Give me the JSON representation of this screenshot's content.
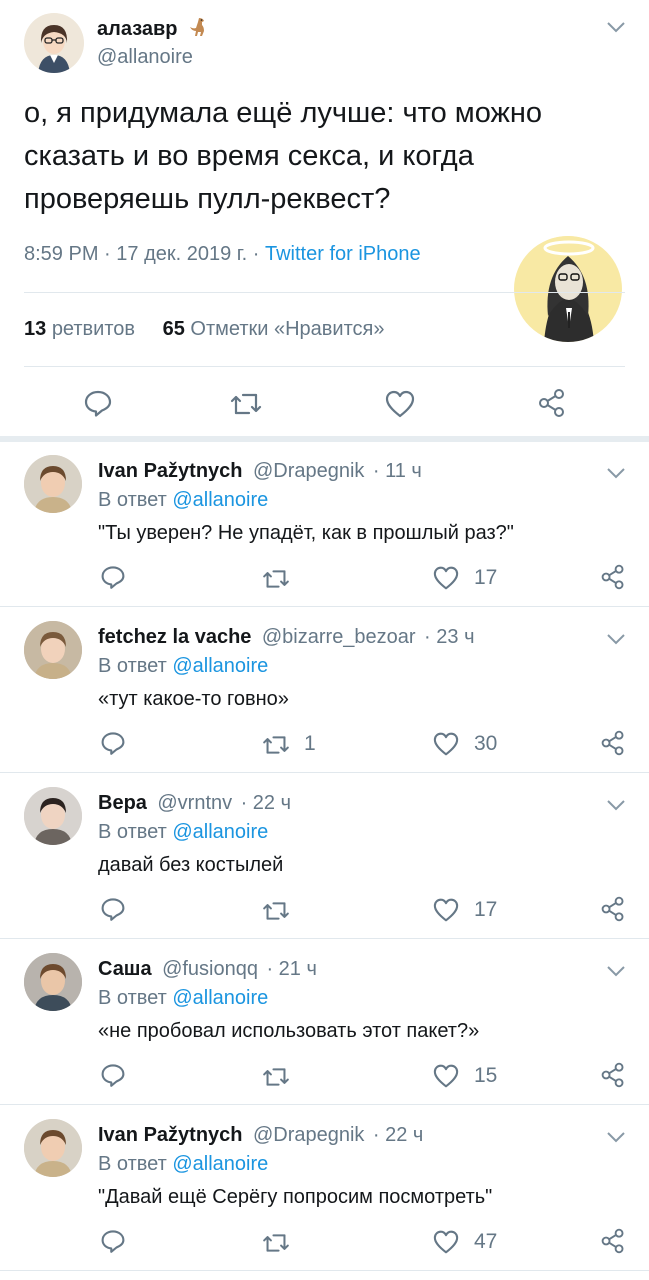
{
  "main_tweet": {
    "display_name": "алазавр",
    "handle": "@allanoire",
    "text_lines": [
      "о, я придумала ещё лучше: что можно",
      "сказать и во время секса, и когда",
      "проверяешь пулл-реквест?"
    ],
    "time": "8:59 PM",
    "date": "17 дек. 2019 г.",
    "separator": "·",
    "source": "Twitter for iPhone",
    "retweets_count": "13",
    "retweets_label": "ретвитов",
    "likes_count": "65",
    "likes_label": "Отметки «Нравится»",
    "icons": [
      "reply-icon",
      "retweet-icon",
      "like-icon",
      "share-icon"
    ]
  },
  "replies": [
    {
      "name": "Ivan Pažytnych",
      "handle": "@Drapegnik",
      "time": "· 11 ч",
      "reply_prefix": "В ответ",
      "reply_to": "@allanoire",
      "text": "\"Ты уверен? Не упадёт, как в прошлый раз?\"",
      "retweets": "",
      "likes": "17"
    },
    {
      "name": "fetchez la vache",
      "handle": "@bizarre_bezoar",
      "time": "· 23 ч",
      "reply_prefix": "В ответ",
      "reply_to": "@allanoire",
      "text": "«тут какое-то говно»",
      "retweets": "1",
      "likes": "30"
    },
    {
      "name": "Вера",
      "handle": "@vrntnv",
      "time": "· 22 ч",
      "reply_prefix": "В ответ",
      "reply_to": "@allanoire",
      "text": "давай без костылей",
      "retweets": "",
      "likes": "17"
    },
    {
      "name": "Саша",
      "handle": "@fusionqq",
      "time": "· 21 ч",
      "reply_prefix": "В ответ",
      "reply_to": "@allanoire",
      "text": "«не пробовал использовать этот пакет?»",
      "retweets": "",
      "likes": "15"
    },
    {
      "name": "Ivan Pažytnych",
      "handle": "@Drapegnik",
      "time": "· 22 ч",
      "reply_prefix": "В ответ",
      "reply_to": "@allanoire",
      "text": "\"Давай ещё Серёгу попросим посмотреть\"",
      "retweets": "",
      "likes": "47"
    }
  ],
  "colors": {
    "link": "#1b95e0",
    "meta": "#657786",
    "divider": "#e1e8ed",
    "icon": "#657786"
  }
}
